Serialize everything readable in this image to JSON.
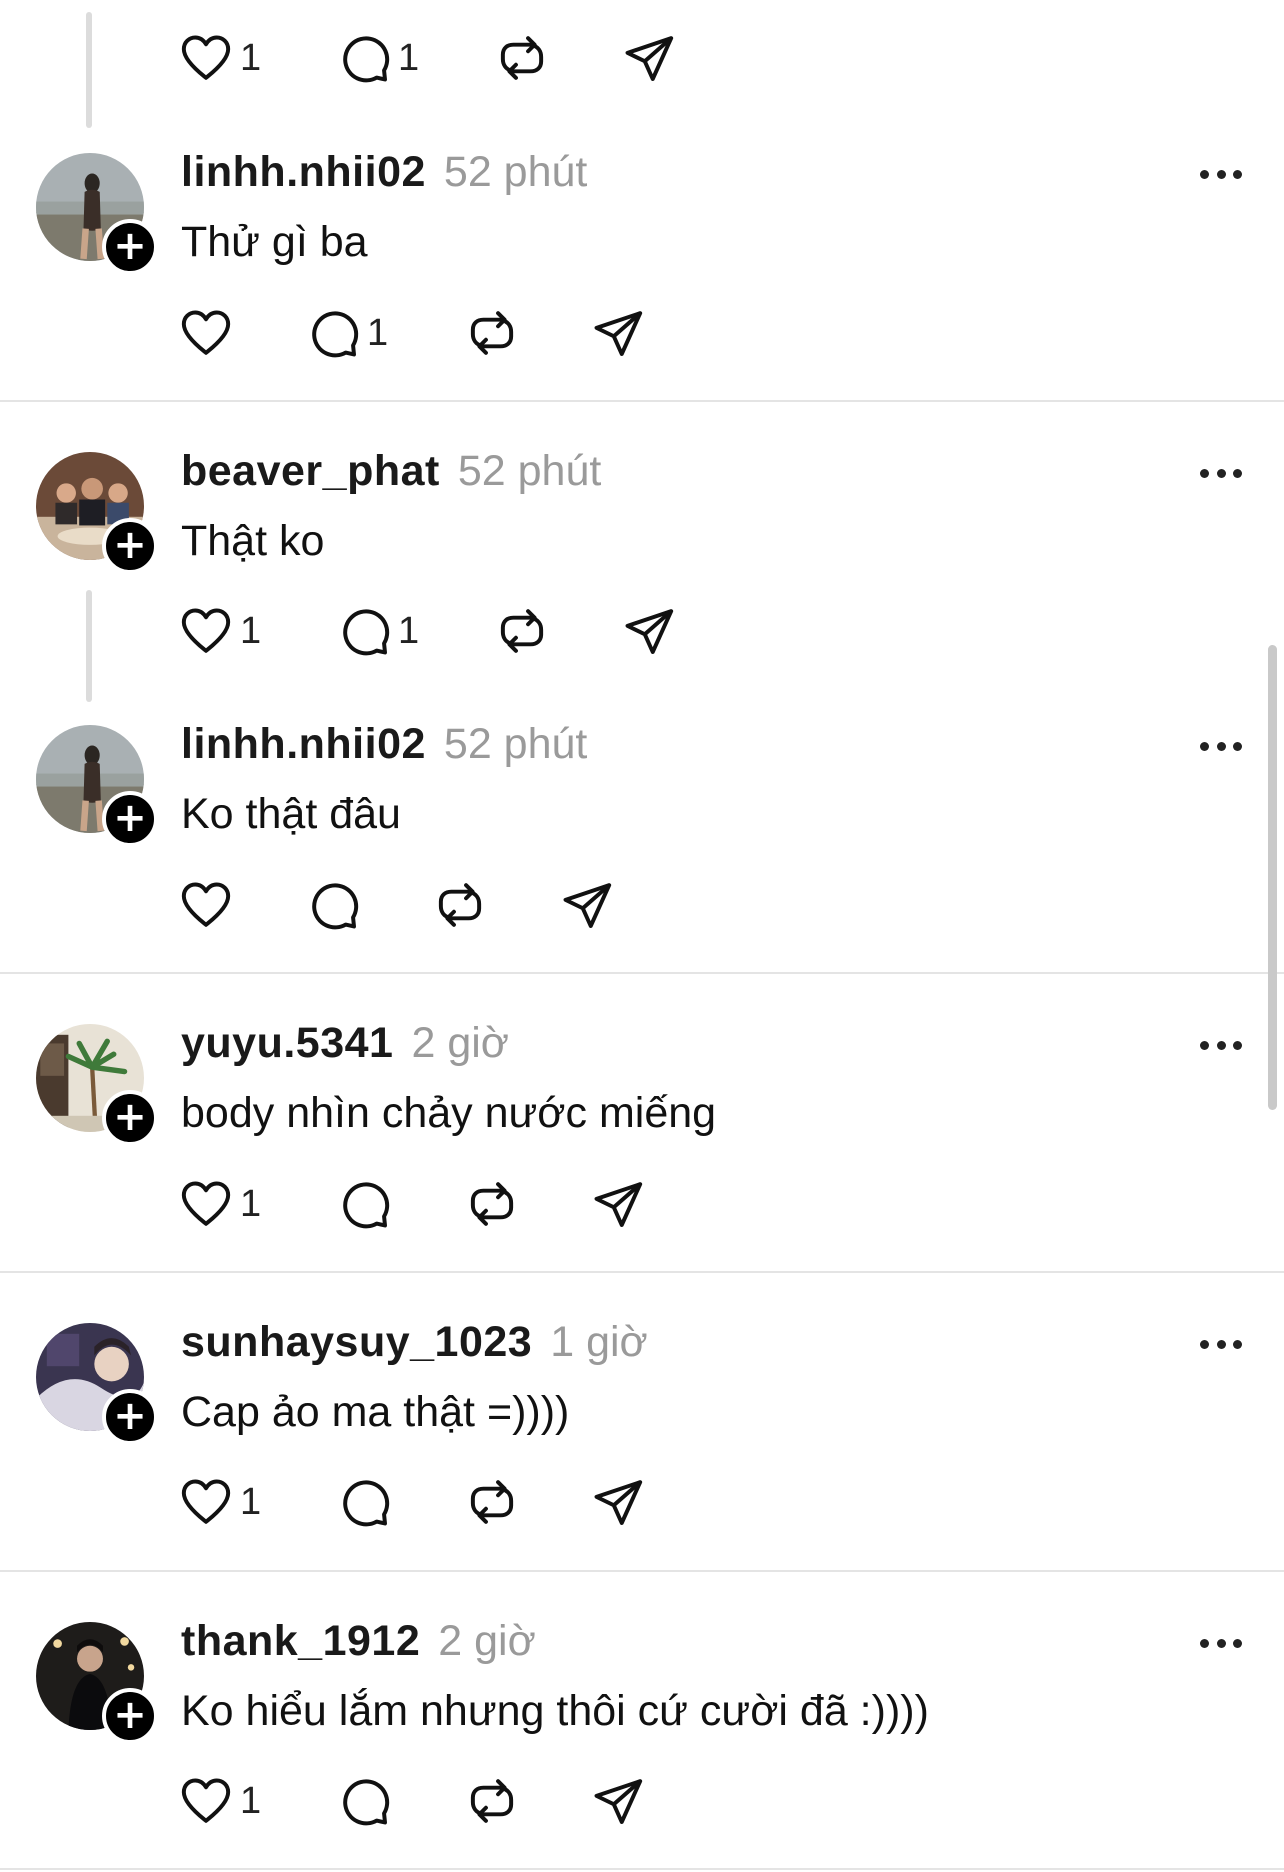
{
  "comments": [
    {
      "username": "",
      "time": "",
      "text": "",
      "likes": "1",
      "replies": "1"
    },
    {
      "username": "linhh.nhii02",
      "time": "52 phút",
      "text": "Thử gì ba",
      "likes": "",
      "replies": "1"
    },
    {
      "username": "beaver_phat",
      "time": "52 phút",
      "text": "Thật ko",
      "likes": "1",
      "replies": "1"
    },
    {
      "username": "linhh.nhii02",
      "time": "52 phút",
      "text": "Ko thật đâu",
      "likes": "",
      "replies": ""
    },
    {
      "username": "yuyu.5341",
      "time": "2 giờ",
      "text": "body nhìn chảy nước miếng",
      "likes": "1",
      "replies": ""
    },
    {
      "username": "sunhaysuy_1023",
      "time": "1 giờ",
      "text": "Cap ảo ma thật =))))",
      "likes": "1",
      "replies": ""
    },
    {
      "username": "thank_1912",
      "time": "2 giờ",
      "text": "Ko hiểu lắm nhưng thôi cứ cười đã :))))",
      "likes": "1",
      "replies": ""
    }
  ],
  "icons": {
    "like": "heart-icon",
    "reply": "comment-bubble-icon",
    "repost": "repost-icon",
    "share": "send-icon",
    "more": "more-options-icon",
    "follow": "plus-icon"
  },
  "colors": {
    "text": "#111111",
    "muted": "#9a9a9a",
    "divider": "#e4e4e4",
    "thread_line": "#dcdcdc"
  }
}
